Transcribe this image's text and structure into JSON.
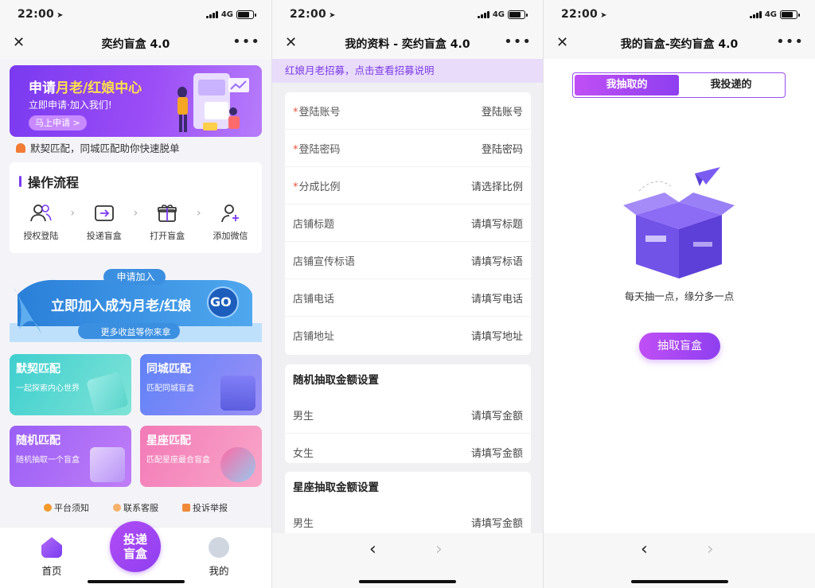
{
  "status": {
    "time": "22:00",
    "network": "4G"
  },
  "screen1": {
    "nav_title": "奕约盲盒 4.0",
    "banner": {
      "prefix": "申请",
      "highlight": "月老/红娘中心",
      "sub": "立即申请·加入我们!",
      "button": "马上申请 >"
    },
    "notice": "默契匹配，同城匹配助你快速脱单",
    "flow": {
      "title": "操作流程",
      "steps": [
        {
          "label": "授权登陆",
          "icon": "users-icon"
        },
        {
          "label": "投递盲盒",
          "icon": "deliver-icon"
        },
        {
          "label": "打开盲盒",
          "icon": "gift-icon"
        },
        {
          "label": "添加微信",
          "icon": "add-user-icon"
        }
      ]
    },
    "go_banner": {
      "tag": "申请加入",
      "headline": "立即加入成为月老/红娘",
      "go": "GO",
      "sub": "更多收益等你来拿"
    },
    "cards": [
      {
        "title": "默契匹配",
        "desc": "一起探索内心世界"
      },
      {
        "title": "同城匹配",
        "desc": "匹配同城盲盒"
      },
      {
        "title": "随机匹配",
        "desc": "随机抽取一个盲盒"
      },
      {
        "title": "星座匹配",
        "desc": "匹配星座最合盲盒"
      }
    ],
    "links": [
      "平台须知",
      "联系客服",
      "投诉举报"
    ],
    "tabs": {
      "home": "首页",
      "center_line1": "投递",
      "center_line2": "盲盒",
      "mine": "我的"
    }
  },
  "screen2": {
    "nav_title": "我的资料 - 奕约盲盒 4.0",
    "recruit": "红娘月老招募，点击查看招募说明",
    "fields": [
      {
        "label": "登陆账号",
        "required": "*",
        "value": "登陆账号"
      },
      {
        "label": "登陆密码",
        "required": "*",
        "value": "登陆密码"
      },
      {
        "label": "分成比例",
        "required": "*",
        "value": "请选择比例"
      },
      {
        "label": "店铺标题",
        "required": "",
        "value": "请填写标题"
      },
      {
        "label": "店铺宣传标语",
        "required": "",
        "value": "请填写标语"
      },
      {
        "label": "店铺电话",
        "required": "",
        "value": "请填写电话"
      },
      {
        "label": "店铺地址",
        "required": "",
        "value": "请填写地址"
      }
    ],
    "random_title": "随机抽取金额设置",
    "random_rows": [
      {
        "label": "男生",
        "value": "请填写金额"
      },
      {
        "label": "女生",
        "value": "请填写金额"
      }
    ],
    "zodiac_title": "星座抽取金额设置",
    "zodiac_rows": [
      {
        "label": "男生",
        "value": "请填写金额"
      }
    ],
    "back": "‹",
    "forward": "›"
  },
  "screen3": {
    "nav_title": "我的盲盒-奕约盲盒 4.0",
    "tab_active": "我抽取的",
    "tab_inactive": "我投递的",
    "empty_text": "每天抽一点，缘分多一点",
    "button": "抽取盲盒"
  },
  "colors": {
    "primary": "#8e3ff0",
    "accent": "#c04ff5",
    "recruit_bg": "#e9dcfb",
    "required": "#e8533a"
  }
}
